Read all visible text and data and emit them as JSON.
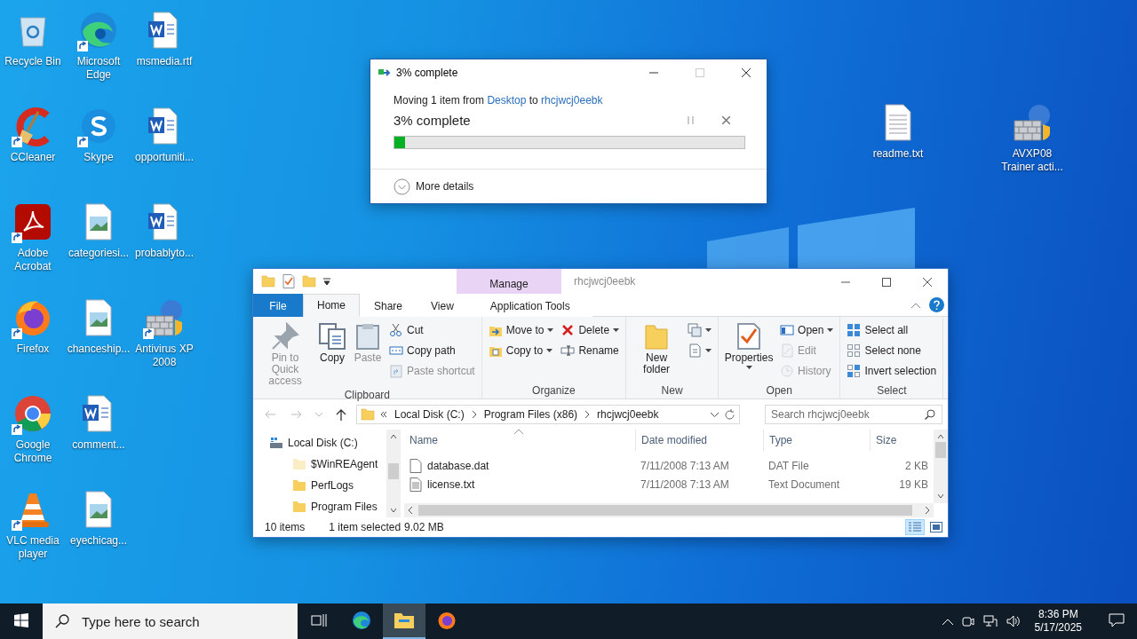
{
  "desktop_icons": [
    {
      "label": "Recycle Bin",
      "kind": "recycle",
      "shortcut": false
    },
    {
      "label": "CCleaner",
      "kind": "ccleaner",
      "shortcut": true
    },
    {
      "label": "Adobe Acrobat",
      "kind": "acrobat",
      "shortcut": true
    },
    {
      "label": "Firefox",
      "kind": "firefox",
      "shortcut": true
    },
    {
      "label": "Google Chrome",
      "kind": "chrome",
      "shortcut": true
    },
    {
      "label": "VLC media player",
      "kind": "vlc",
      "shortcut": true
    },
    {
      "label": "Microsoft Edge",
      "kind": "edge",
      "shortcut": true
    },
    {
      "label": "Skype",
      "kind": "skype",
      "shortcut": true
    },
    {
      "label": "categoriesi...",
      "kind": "image",
      "shortcut": false
    },
    {
      "label": "chanceship...",
      "kind": "image",
      "shortcut": false
    },
    {
      "label": "comment...",
      "kind": "word",
      "shortcut": false
    },
    {
      "label": "eyechicag...",
      "kind": "image",
      "shortcut": false
    },
    {
      "label": "msmedia.rtf",
      "kind": "word",
      "shortcut": false
    },
    {
      "label": "opportuniti...",
      "kind": "word",
      "shortcut": false
    },
    {
      "label": "probablyto...",
      "kind": "word",
      "shortcut": false
    },
    {
      "label": "Antivirus XP 2008",
      "kind": "firewall",
      "shortcut": true
    }
  ],
  "desktop_icons_right": [
    {
      "label": "readme.txt",
      "kind": "text",
      "shortcut": false
    },
    {
      "label": "AVXP08 Trainer acti...",
      "kind": "firewall",
      "shortcut": false
    }
  ],
  "progress_dialog": {
    "title": "3% complete",
    "message": {
      "prefix": "Moving 1 item from",
      "source": "Desktop",
      "middle": "to",
      "destination": "rhcjwcj0eebk"
    },
    "status": "3% complete",
    "level": 0.03,
    "more_details": "More details"
  },
  "explorer": {
    "contextual_header": "Manage",
    "title": "rhcjwcj0eebk",
    "tabs": [
      {
        "label": "File",
        "kind": "file",
        "selected": false
      },
      {
        "label": "Home",
        "kind": "tab",
        "selected": true
      },
      {
        "label": "Share",
        "kind": "tab",
        "selected": false
      },
      {
        "label": "View",
        "kind": "tab",
        "selected": false
      },
      {
        "label": "Application Tools",
        "kind": "contextual",
        "selected": false
      }
    ],
    "ribbon_groups": [
      {
        "label": "Clipboard",
        "columns": [
          [
            {
              "label": "Pin to Quick access",
              "kind": "large",
              "disabled": true,
              "dropdown": false
            }
          ],
          [
            {
              "label": "Copy",
              "kind": "large",
              "disabled": false,
              "dropdown": false
            }
          ],
          [
            {
              "label": "Paste",
              "kind": "large",
              "disabled": true,
              "dropdown": false
            }
          ],
          [
            {
              "label": "Cut",
              "kind": "small",
              "disabled": false,
              "dropdown": false
            },
            {
              "label": "Copy path",
              "kind": "small",
              "disabled": false,
              "dropdown": false
            },
            {
              "label": "Paste shortcut",
              "kind": "small",
              "disabled": true,
              "dropdown": false
            }
          ]
        ]
      },
      {
        "label": "Organize",
        "columns": [
          [
            {
              "label": "Move to",
              "kind": "small",
              "disabled": false,
              "dropdown": true
            },
            {
              "label": "Copy to",
              "kind": "small",
              "disabled": false,
              "dropdown": true
            }
          ],
          [
            {
              "label": "Delete",
              "kind": "small",
              "disabled": false,
              "dropdown": true
            },
            {
              "label": "Rename",
              "kind": "small",
              "disabled": false,
              "dropdown": false
            }
          ]
        ]
      },
      {
        "label": "New",
        "columns": [
          [
            {
              "label": "New folder",
              "kind": "large",
              "disabled": false,
              "dropdown": false
            }
          ],
          [
            {
              "kind": "icon",
              "disabled": false,
              "dropdown": true
            },
            {
              "kind": "icon",
              "disabled": false,
              "dropdown": true
            }
          ]
        ]
      },
      {
        "label": "Open",
        "columns": [
          [
            {
              "label": "Properties",
              "kind": "large",
              "disabled": false,
              "dropdown": true
            }
          ],
          [
            {
              "label": "Open",
              "kind": "small",
              "disabled": false,
              "dropdown": true
            },
            {
              "label": "Edit",
              "kind": "small",
              "disabled": true,
              "dropdown": false
            },
            {
              "label": "History",
              "kind": "small",
              "disabled": true,
              "dropdown": false
            }
          ]
        ]
      },
      {
        "label": "Select",
        "columns": [
          [
            {
              "label": "Select all",
              "kind": "small",
              "disabled": false,
              "dropdown": false
            },
            {
              "label": "Select none",
              "kind": "small",
              "disabled": false,
              "dropdown": false
            },
            {
              "label": "Invert selection",
              "kind": "small",
              "disabled": false,
              "dropdown": false
            }
          ]
        ]
      }
    ],
    "address": [
      "Local Disk (C:)",
      "Program Files (x86)",
      "rhcjwcj0eebk"
    ],
    "search": {
      "placeholder": "Search rhcjwcj0eebk"
    },
    "navigation_tree": [
      {
        "label": "Local Disk (C:)",
        "kind": "drive",
        "children": [
          {
            "label": "$WinREAgent",
            "kind": "folder",
            "hidden": true
          },
          {
            "label": "PerfLogs",
            "kind": "folder",
            "hidden": false
          },
          {
            "label": "Program Files",
            "kind": "folder",
            "hidden": false
          }
        ]
      }
    ],
    "columns": [
      "Name",
      "Date modified",
      "Type",
      "Size"
    ],
    "rows": [
      {
        "name": "database.dat",
        "date": "7/11/2008 7:13 AM",
        "type": "DAT File",
        "size": "2 KB",
        "kind": "data",
        "selected": false
      },
      {
        "name": "license.txt",
        "date": "7/11/2008 7:13 AM",
        "type": "Text Document",
        "size": "19 KB",
        "kind": "text",
        "selected": false
      }
    ],
    "status_bar": {
      "items": "10 items",
      "selection": "1 item selected",
      "size": "9.02 MB"
    },
    "view_buttons": [
      {
        "kind": "details",
        "selected": true
      },
      {
        "kind": "large-icons",
        "selected": false
      }
    ]
  },
  "taskbar": {
    "search_placeholder": "Type here to search",
    "apps": [
      {
        "kind": "taskview",
        "active": false
      },
      {
        "kind": "edge",
        "active": false
      },
      {
        "kind": "explorer",
        "active": true
      },
      {
        "kind": "firefox",
        "active": false
      }
    ],
    "time": "8:36 PM",
    "date": "5/17/2025"
  }
}
